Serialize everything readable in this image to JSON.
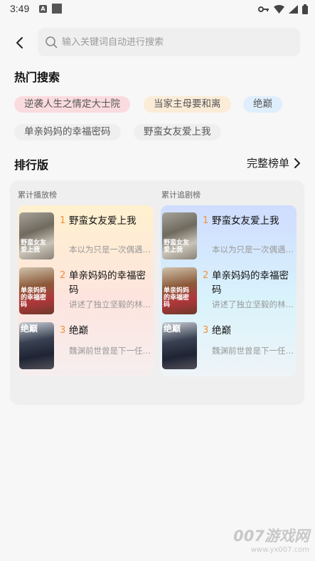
{
  "status_bar": {
    "time": "3:49",
    "notification_a": "A"
  },
  "search": {
    "placeholder": "输入关键词自动进行搜索"
  },
  "hot_search": {
    "title": "热门搜索",
    "tags": [
      "逆袭人生之情定大士院",
      "当家主母要和离",
      "绝巅",
      "单亲妈妈的幸福密码",
      "野蛮女友爱上我"
    ]
  },
  "ranking": {
    "title": "排行版",
    "full_list_label": "完整榜单",
    "columns": [
      {
        "label": "累计播放榜",
        "items": [
          {
            "rank": "1",
            "name": "野蛮女友爱上我",
            "desc": "本以为只是一次偶遇…",
            "poster_text": "野蛮女友爱上我"
          },
          {
            "rank": "2",
            "name": "单亲妈妈的幸福密码",
            "desc": "讲述了独立坚毅的林…",
            "poster_text": "单亲妈妈的幸福密码"
          },
          {
            "rank": "3",
            "name": "绝巅",
            "desc": "魏渊前世曾是下一任…",
            "poster_text": "绝巅"
          }
        ]
      },
      {
        "label": "累计追剧榜",
        "items": [
          {
            "rank": "1",
            "name": "野蛮女友爱上我",
            "desc": "本以为只是一次偶遇…",
            "poster_text": "野蛮女友爱上我"
          },
          {
            "rank": "2",
            "name": "单亲妈妈的幸福密码",
            "desc": "讲述了独立坚毅的林…",
            "poster_text": "单亲妈妈的幸福密码"
          },
          {
            "rank": "3",
            "name": "绝巅",
            "desc": "魏渊前世曾是下一任…",
            "poster_text": "绝巅"
          }
        ]
      }
    ]
  },
  "watermark": {
    "brand": "007游戏网",
    "url": "www.yx007.com"
  },
  "colors": {
    "rank_number": "#f0903a",
    "tag_pink": "#fadbde",
    "tag_orange": "#fbecd8",
    "tag_blue": "#dfeefc"
  }
}
